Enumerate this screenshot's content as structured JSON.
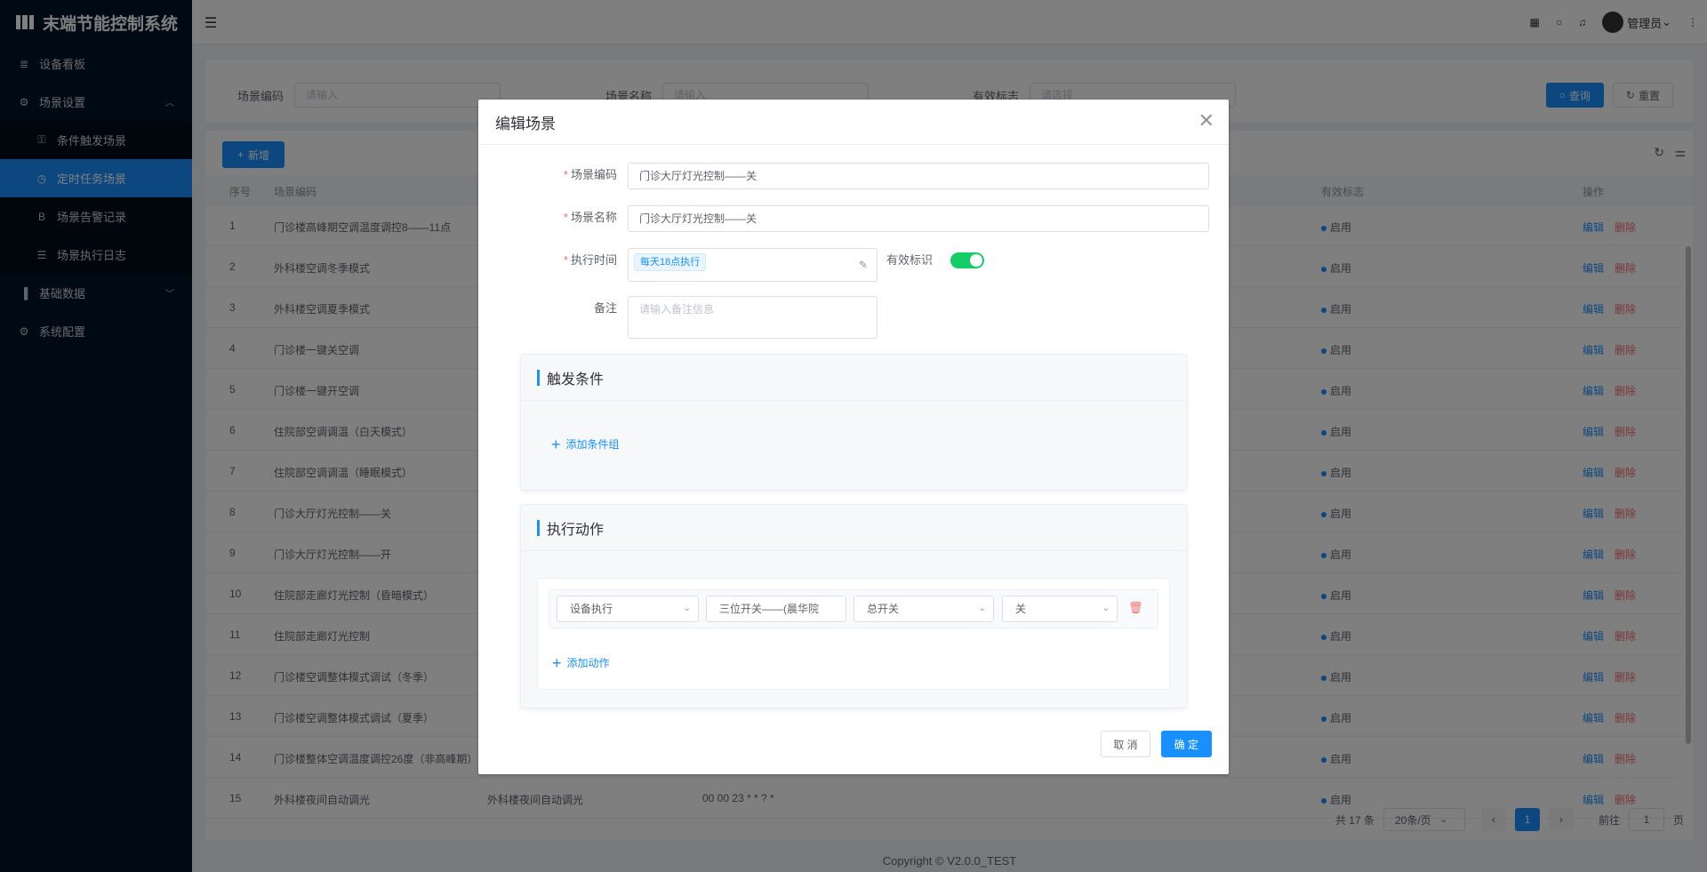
{
  "app": {
    "title": "末端节能控制系统"
  },
  "sidebar": {
    "items": [
      {
        "label": "设备看板",
        "icon": "≣"
      },
      {
        "label": "场景设置",
        "icon": "⚙",
        "expanded": true
      },
      {
        "label": "条件触发场景",
        "icon": "⚿"
      },
      {
        "label": "定时任务场景",
        "icon": "◷",
        "active": true
      },
      {
        "label": "场景告警记录",
        "icon": "B"
      },
      {
        "label": "场景执行日志",
        "icon": "☰"
      },
      {
        "label": "基础数据",
        "icon": "▐"
      },
      {
        "label": "系统配置",
        "icon": "⚙"
      }
    ]
  },
  "header": {
    "user": "管理员"
  },
  "search": {
    "code_label": "场景编码",
    "code_placeholder": "请输入",
    "name_label": "场景名称",
    "name_placeholder": "请输入",
    "flag_label": "有效标志",
    "flag_placeholder": "请选择",
    "query": "查询",
    "reset": "重置"
  },
  "toolbar": {
    "add": "新增"
  },
  "table": {
    "headers": {
      "index": "序号",
      "code": "场景编码",
      "flag": "有效标志",
      "ops": "操作"
    },
    "rows": [
      {
        "index": "1",
        "code": "门诊楼高峰期空调温度调控8——11点",
        "name": "",
        "cron": "",
        "status": "启用"
      },
      {
        "index": "2",
        "code": "外科楼空调冬季模式",
        "name": "",
        "cron": "",
        "status": "启用"
      },
      {
        "index": "3",
        "code": "外科楼空调夏季模式",
        "name": "",
        "cron": "",
        "status": "启用"
      },
      {
        "index": "4",
        "code": "门诊楼一键关空调",
        "name": "",
        "cron": "",
        "status": "启用"
      },
      {
        "index": "5",
        "code": "门诊楼一键开空调",
        "name": "",
        "cron": "",
        "status": "启用"
      },
      {
        "index": "6",
        "code": "住院部空调调温（白天模式）",
        "name": "",
        "cron": "",
        "status": "启用"
      },
      {
        "index": "7",
        "code": "住院部空调调温（睡眠模式）",
        "name": "",
        "cron": "",
        "status": "启用"
      },
      {
        "index": "8",
        "code": "门诊大厅灯光控制——关",
        "name": "",
        "cron": "",
        "status": "启用"
      },
      {
        "index": "9",
        "code": "门诊大厅灯光控制——开",
        "name": "",
        "cron": "",
        "status": "启用"
      },
      {
        "index": "10",
        "code": "住院部走廊灯光控制（昏暗模式）",
        "name": "",
        "cron": "",
        "status": "启用"
      },
      {
        "index": "11",
        "code": "住院部走廊灯光控制",
        "name": "",
        "cron": "",
        "status": "启用"
      },
      {
        "index": "12",
        "code": "门诊楼空调整体模式调试（冬季）",
        "name": "",
        "cron": "",
        "status": "启用"
      },
      {
        "index": "13",
        "code": "门诊楼空调整体模式调试（夏季）",
        "name": "",
        "cron": "",
        "status": "启用"
      },
      {
        "index": "14",
        "code": "门诊楼整体空调温度调控26度（非高峰期）",
        "name": "",
        "cron": "",
        "status": "启用"
      },
      {
        "index": "15",
        "code": "外科楼夜间自动调光",
        "name": "外科楼夜间自动调光",
        "cron": "00 00 23 * * ? *",
        "status": "启用"
      }
    ],
    "edit": "编辑",
    "delete": "删除"
  },
  "pagination": {
    "total": "共 17 条",
    "page_size": "20条/页",
    "current": "1",
    "goto": "前往",
    "goto_value": "1",
    "page_unit": "页"
  },
  "copyright": "Copyright © V2.0.0_TEST",
  "dialog": {
    "title": "编辑场景",
    "code_label": "场景编码",
    "code_value": "门诊大厅灯光控制——关",
    "name_label": "场景名称",
    "name_value": "门诊大厅灯光控制——关",
    "time_label": "执行时间",
    "time_tag": "每天18点执行",
    "valid_label": "有效标识",
    "remark_label": "备注",
    "remark_placeholder": "请输入备注信息",
    "trigger_title": "触发条件",
    "add_condition": "添加条件组",
    "action_title": "执行动作",
    "action_type": "设备执行",
    "action_device": "三位开关——(晨华院",
    "action_point": "总开关",
    "action_value": "关",
    "add_action": "添加动作",
    "cancel": "取 消",
    "confirm": "确 定"
  }
}
